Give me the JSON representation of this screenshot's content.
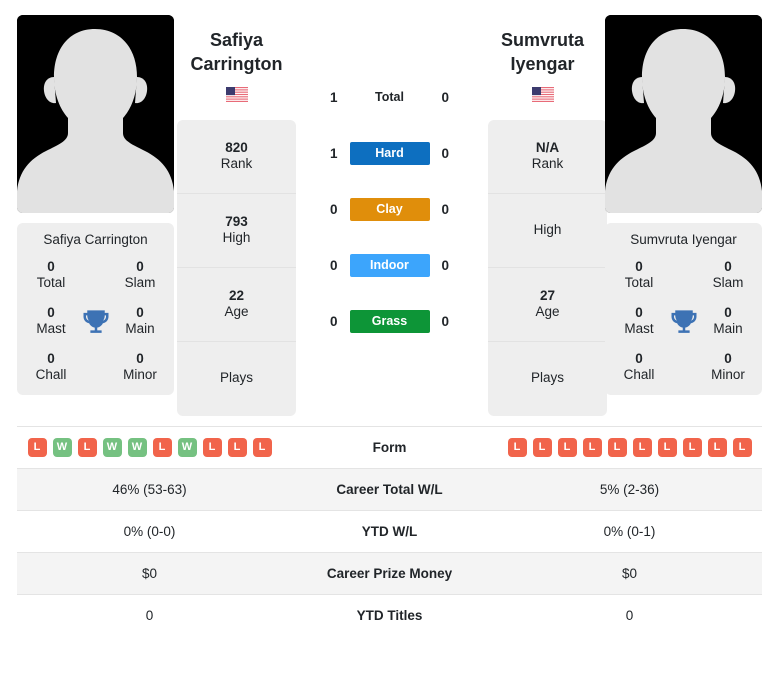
{
  "players": {
    "left": {
      "name_lines": [
        "Safiya",
        "Carrington"
      ],
      "full_name": "Safiya Carrington",
      "flag": "🇺🇸",
      "flag_country": "United States",
      "avatar": "player-silhouette-placeholder",
      "rank": {
        "value": "820",
        "label": "Rank"
      },
      "high": {
        "value": "793",
        "label": "High"
      },
      "age": {
        "value": "22",
        "label": "Age"
      },
      "plays": {
        "value": "",
        "label": "Plays"
      },
      "titles": {
        "total": {
          "value": "0",
          "label": "Total"
        },
        "slam": {
          "value": "0",
          "label": "Slam"
        },
        "mast": {
          "value": "0",
          "label": "Mast"
        },
        "main": {
          "value": "0",
          "label": "Main"
        },
        "chall": {
          "value": "0",
          "label": "Chall"
        },
        "minor": {
          "value": "0",
          "label": "Minor"
        }
      },
      "form": [
        "L",
        "W",
        "L",
        "W",
        "W",
        "L",
        "W",
        "L",
        "L",
        "L"
      ],
      "career_total_wl": "46% (53-63)",
      "ytd_wl": "0% (0-0)",
      "career_prize_money": "$0",
      "ytd_titles": "0"
    },
    "right": {
      "name_lines": [
        "Sumvruta",
        "Iyengar"
      ],
      "full_name": "Sumvruta Iyengar",
      "flag": "🇺🇸",
      "flag_country": "United States",
      "avatar": "player-silhouette-placeholder",
      "rank": {
        "value": "N/A",
        "label": "Rank"
      },
      "high": {
        "value": "",
        "label": "High"
      },
      "age": {
        "value": "27",
        "label": "Age"
      },
      "plays": {
        "value": "",
        "label": "Plays"
      },
      "titles": {
        "total": {
          "value": "0",
          "label": "Total"
        },
        "slam": {
          "value": "0",
          "label": "Slam"
        },
        "mast": {
          "value": "0",
          "label": "Mast"
        },
        "main": {
          "value": "0",
          "label": "Main"
        },
        "chall": {
          "value": "0",
          "label": "Chall"
        },
        "minor": {
          "value": "0",
          "label": "Minor"
        }
      },
      "form": [
        "L",
        "L",
        "L",
        "L",
        "L",
        "L",
        "L",
        "L",
        "L",
        "L"
      ],
      "career_total_wl": "5% (2-36)",
      "ytd_wl": "0% (0-1)",
      "career_prize_money": "$0",
      "ytd_titles": "0"
    }
  },
  "h2h": {
    "rows": [
      {
        "label": "Total",
        "left": "1",
        "right": "0",
        "color": "",
        "style": "plain"
      },
      {
        "label": "Hard",
        "left": "1",
        "right": "0",
        "color": "#0d6fc0",
        "style": "badge"
      },
      {
        "label": "Clay",
        "left": "0",
        "right": "0",
        "color": "#e08e0b",
        "style": "badge"
      },
      {
        "label": "Indoor",
        "left": "0",
        "right": "0",
        "color": "#3ca5fc",
        "style": "badge"
      },
      {
        "label": "Grass",
        "left": "0",
        "right": "0",
        "color": "#0d9537",
        "style": "badge"
      }
    ]
  },
  "table": {
    "rows": [
      {
        "label": "Form",
        "key": "form",
        "type": "form"
      },
      {
        "label": "Career Total W/L",
        "key": "career_total_wl",
        "type": "text"
      },
      {
        "label": "YTD W/L",
        "key": "ytd_wl",
        "type": "text"
      },
      {
        "label": "Career Prize Money",
        "key": "career_prize_money",
        "type": "text"
      },
      {
        "label": "YTD Titles",
        "key": "ytd_titles",
        "type": "text"
      }
    ]
  },
  "colors": {
    "hard": "#0d6fc0",
    "clay": "#e08e0b",
    "indoor": "#3ca5fc",
    "grass": "#0d9537",
    "win": "#75c181",
    "loss": "#f1644b",
    "card_bg": "#eeeeee",
    "row_alt": "#f4f4f4",
    "trophy": "#3d72b4"
  }
}
